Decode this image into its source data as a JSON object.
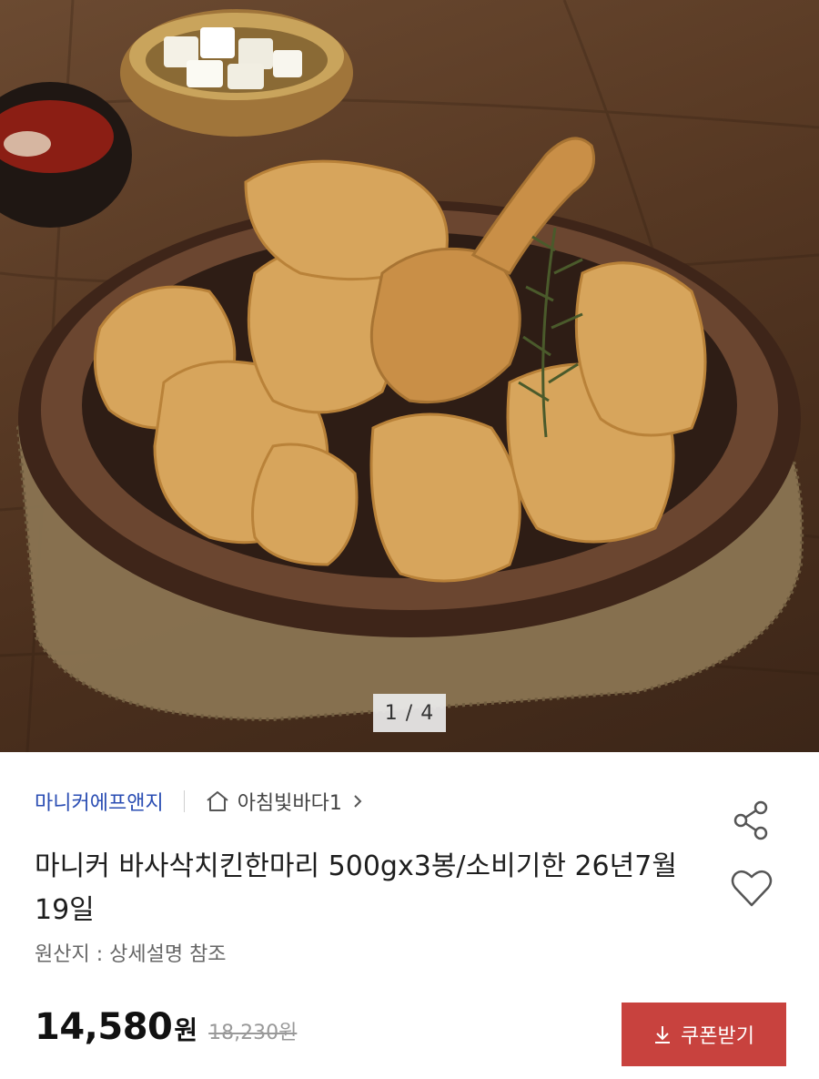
{
  "gallery": {
    "current_page": "1",
    "total_pages": "4",
    "indicator": "1 / 4"
  },
  "seller": {
    "brand": "마니커에프앤지",
    "store_name": "아침빛바다1"
  },
  "product": {
    "title": "마니커 바사삭치킨한마리 500gx3봉/소비기한 26년7월19일",
    "origin": "원산지 : 상세설명 참조",
    "price": "14,580",
    "price_unit": "원",
    "original_price": "18,230원"
  },
  "actions": {
    "coupon_label": "쿠폰받기"
  },
  "icons": {
    "home": "home-icon",
    "chevron": "chevron-right-icon",
    "share": "share-icon",
    "like": "heart-icon",
    "download": "download-icon"
  },
  "colors": {
    "brand_link": "#2a4db3",
    "coupon_button": "#c8423e",
    "price": "#111111"
  }
}
